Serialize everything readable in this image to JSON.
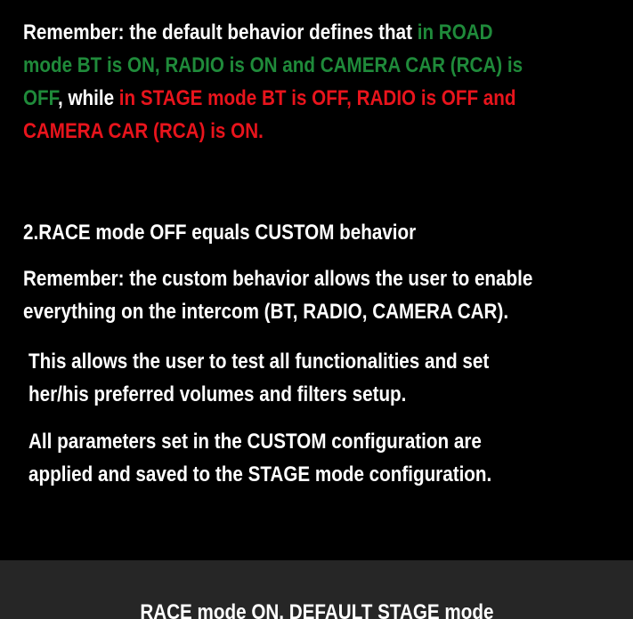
{
  "default_note": {
    "l1_white": "Remember: the default behavior defines that ",
    "l1_green": "in ROAD",
    "l2_green": "mode BT is ON, RADIO is ON and CAMERA CAR (RCA) is",
    "l3_green": "OFF",
    "l3_white": ", while ",
    "l3_red": "in STAGE mode BT is OFF, RADIO is OFF and",
    "l4_red": "CAMERA CAR (RCA) is ON."
  },
  "race_off_heading": "2.RACE mode OFF equals CUSTOM behavior",
  "custom_note": {
    "l1": "Remember: the custom behavior allows the user to enable",
    "l2": "everything on the intercom (BT, RADIO, CAMERA CAR)."
  },
  "test_note": {
    "l1": "This allows the user to test all functionalities and set",
    "l2": "her/his preferred volumes and filters setup."
  },
  "params_note": {
    "l1": "All parameters set in the CUSTOM configuration are",
    "l2": "applied and saved to the STAGE mode configuration."
  },
  "next_slide_title": "RACE mode ON, DEFAULT STAGE mode",
  "colors": {
    "background": "#000000",
    "text": "#ffffff",
    "road_green": "#1f8a3a",
    "stage_red": "#e8141c",
    "next_slide_bg": "#262626"
  }
}
